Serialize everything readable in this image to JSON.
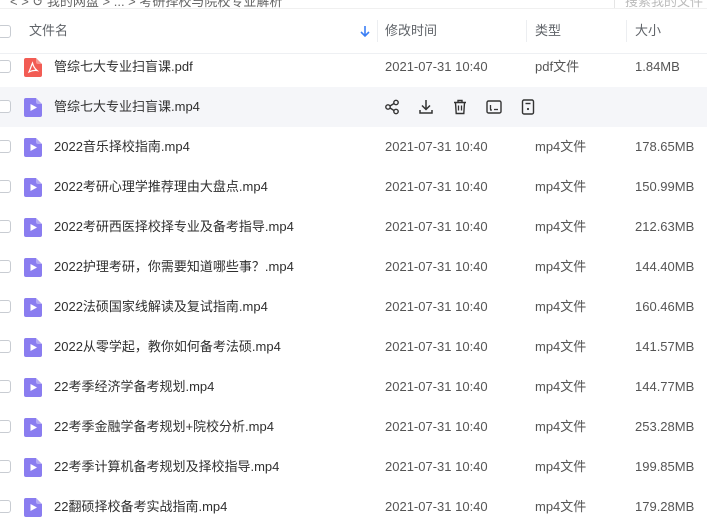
{
  "topbar": {
    "breadcrumb": "< > ↺  我的网盘 > ... > 考研择校与院校专业解析",
    "search_placeholder": "搜索我的文件"
  },
  "header": {
    "col_name": "文件名",
    "col_time": "修改时间",
    "col_type": "类型",
    "col_size": "大小"
  },
  "files": [
    {
      "name": "管综七大专业扫盲课.pdf",
      "time": "2021-07-31 10:40",
      "type": "pdf文件",
      "size": "1.84MB",
      "icon": "pdf-file-icon"
    },
    {
      "name": "管综七大专业扫盲课.mp4",
      "time": "",
      "type": "",
      "size": "",
      "icon": "video-file-icon",
      "hover": true
    },
    {
      "name": "2022音乐择校指南.mp4",
      "time": "2021-07-31 10:40",
      "type": "mp4文件",
      "size": "178.65MB",
      "icon": "video-file-icon"
    },
    {
      "name": "2022考研心理学推荐理由大盘点.mp4",
      "time": "2021-07-31 10:40",
      "type": "mp4文件",
      "size": "150.99MB",
      "icon": "video-file-icon"
    },
    {
      "name": "2022考研西医择校择专业及备考指导.mp4",
      "time": "2021-07-31 10:40",
      "type": "mp4文件",
      "size": "212.63MB",
      "icon": "video-file-icon"
    },
    {
      "name": "2022护理考研，你需要知道哪些事？.mp4",
      "time": "2021-07-31 10:40",
      "type": "mp4文件",
      "size": "144.40MB",
      "icon": "video-file-icon"
    },
    {
      "name": "2022法硕国家线解读及复试指南.mp4",
      "time": "2021-07-31 10:40",
      "type": "mp4文件",
      "size": "160.46MB",
      "icon": "video-file-icon"
    },
    {
      "name": "2022从零学起，教你如何备考法硕.mp4",
      "time": "2021-07-31 10:40",
      "type": "mp4文件",
      "size": "141.57MB",
      "icon": "video-file-icon"
    },
    {
      "name": "22考季经济学备考规划.mp4",
      "time": "2021-07-31 10:40",
      "type": "mp4文件",
      "size": "144.77MB",
      "icon": "video-file-icon"
    },
    {
      "name": "22考季金融学备考规划+院校分析.mp4",
      "time": "2021-07-31 10:40",
      "type": "mp4文件",
      "size": "253.28MB",
      "icon": "video-file-icon"
    },
    {
      "name": "22考季计算机备考规划及择校指导.mp4",
      "time": "2021-07-31 10:40",
      "type": "mp4文件",
      "size": "199.85MB",
      "icon": "video-file-icon"
    },
    {
      "name": "22翻硕择校备考实战指南.mp4",
      "time": "2021-07-31 10:40",
      "type": "mp4文件",
      "size": "179.28MB",
      "icon": "video-file-icon"
    }
  ],
  "row_actions": [
    "share-icon",
    "download-icon",
    "delete-icon",
    "rename-icon",
    "more-info-icon"
  ],
  "colors": {
    "pdf": "#f25c54",
    "video": "#8a7df0",
    "accent": "#3b7ff5"
  }
}
